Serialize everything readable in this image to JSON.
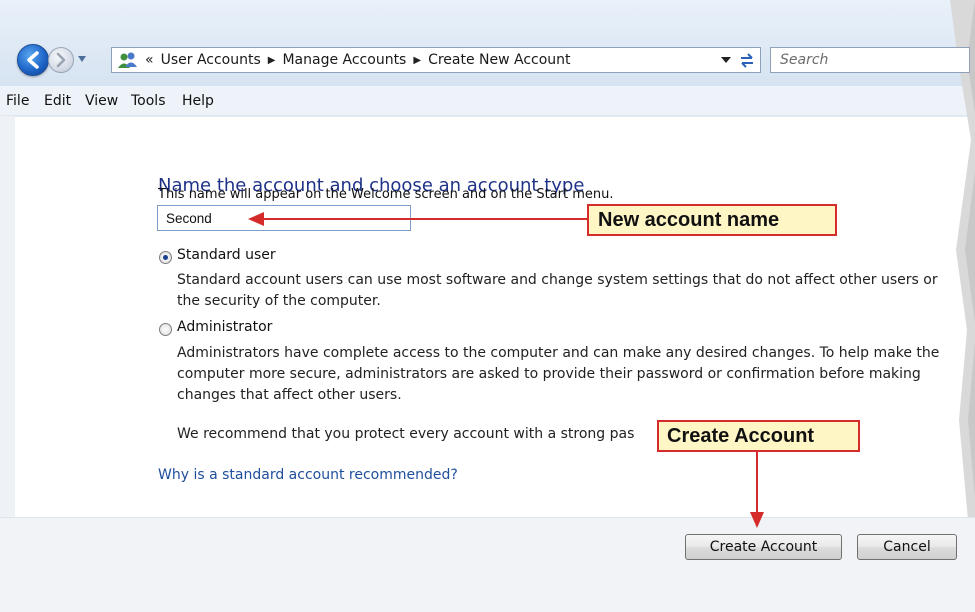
{
  "address_bar": {
    "breadcrumbs": [
      "User Accounts",
      "Manage Accounts",
      "Create New Account"
    ],
    "overflow_glyph": "«",
    "search_placeholder": "Search"
  },
  "menu": [
    "File",
    "Edit",
    "View",
    "Tools",
    "Help"
  ],
  "content": {
    "heading": "Name the account and choose an account type",
    "description": "This name will appear on the Welcome screen and on the Start menu.",
    "account_name_value": "Second",
    "options": [
      {
        "label": "Standard user",
        "selected": true,
        "description": "Standard account users can use most software and change system settings that do not affect other users or the security of the computer."
      },
      {
        "label": "Administrator",
        "selected": false,
        "description": "Administrators have complete access to the computer and can make any desired changes. To help make the computer more secure, administrators are asked to provide their password or confirmation before making changes that affect other users."
      }
    ],
    "recommendation": "We recommend that you protect every account with a strong pas",
    "help_link": "Why is a standard account recommended?"
  },
  "buttons": {
    "create": "Create Account",
    "cancel": "Cancel"
  },
  "callouts": {
    "name": "New account name",
    "create": "Create Account"
  },
  "colors": {
    "heading": "#1e3287",
    "link": "#1f4e9c",
    "callout_fill": "#fff6c6",
    "callout_border": "#d52b2b"
  },
  "icons": [
    "back-icon",
    "forward-icon",
    "history-dropdown-icon",
    "users-icon",
    "address-dropdown-icon",
    "refresh-icon"
  ]
}
